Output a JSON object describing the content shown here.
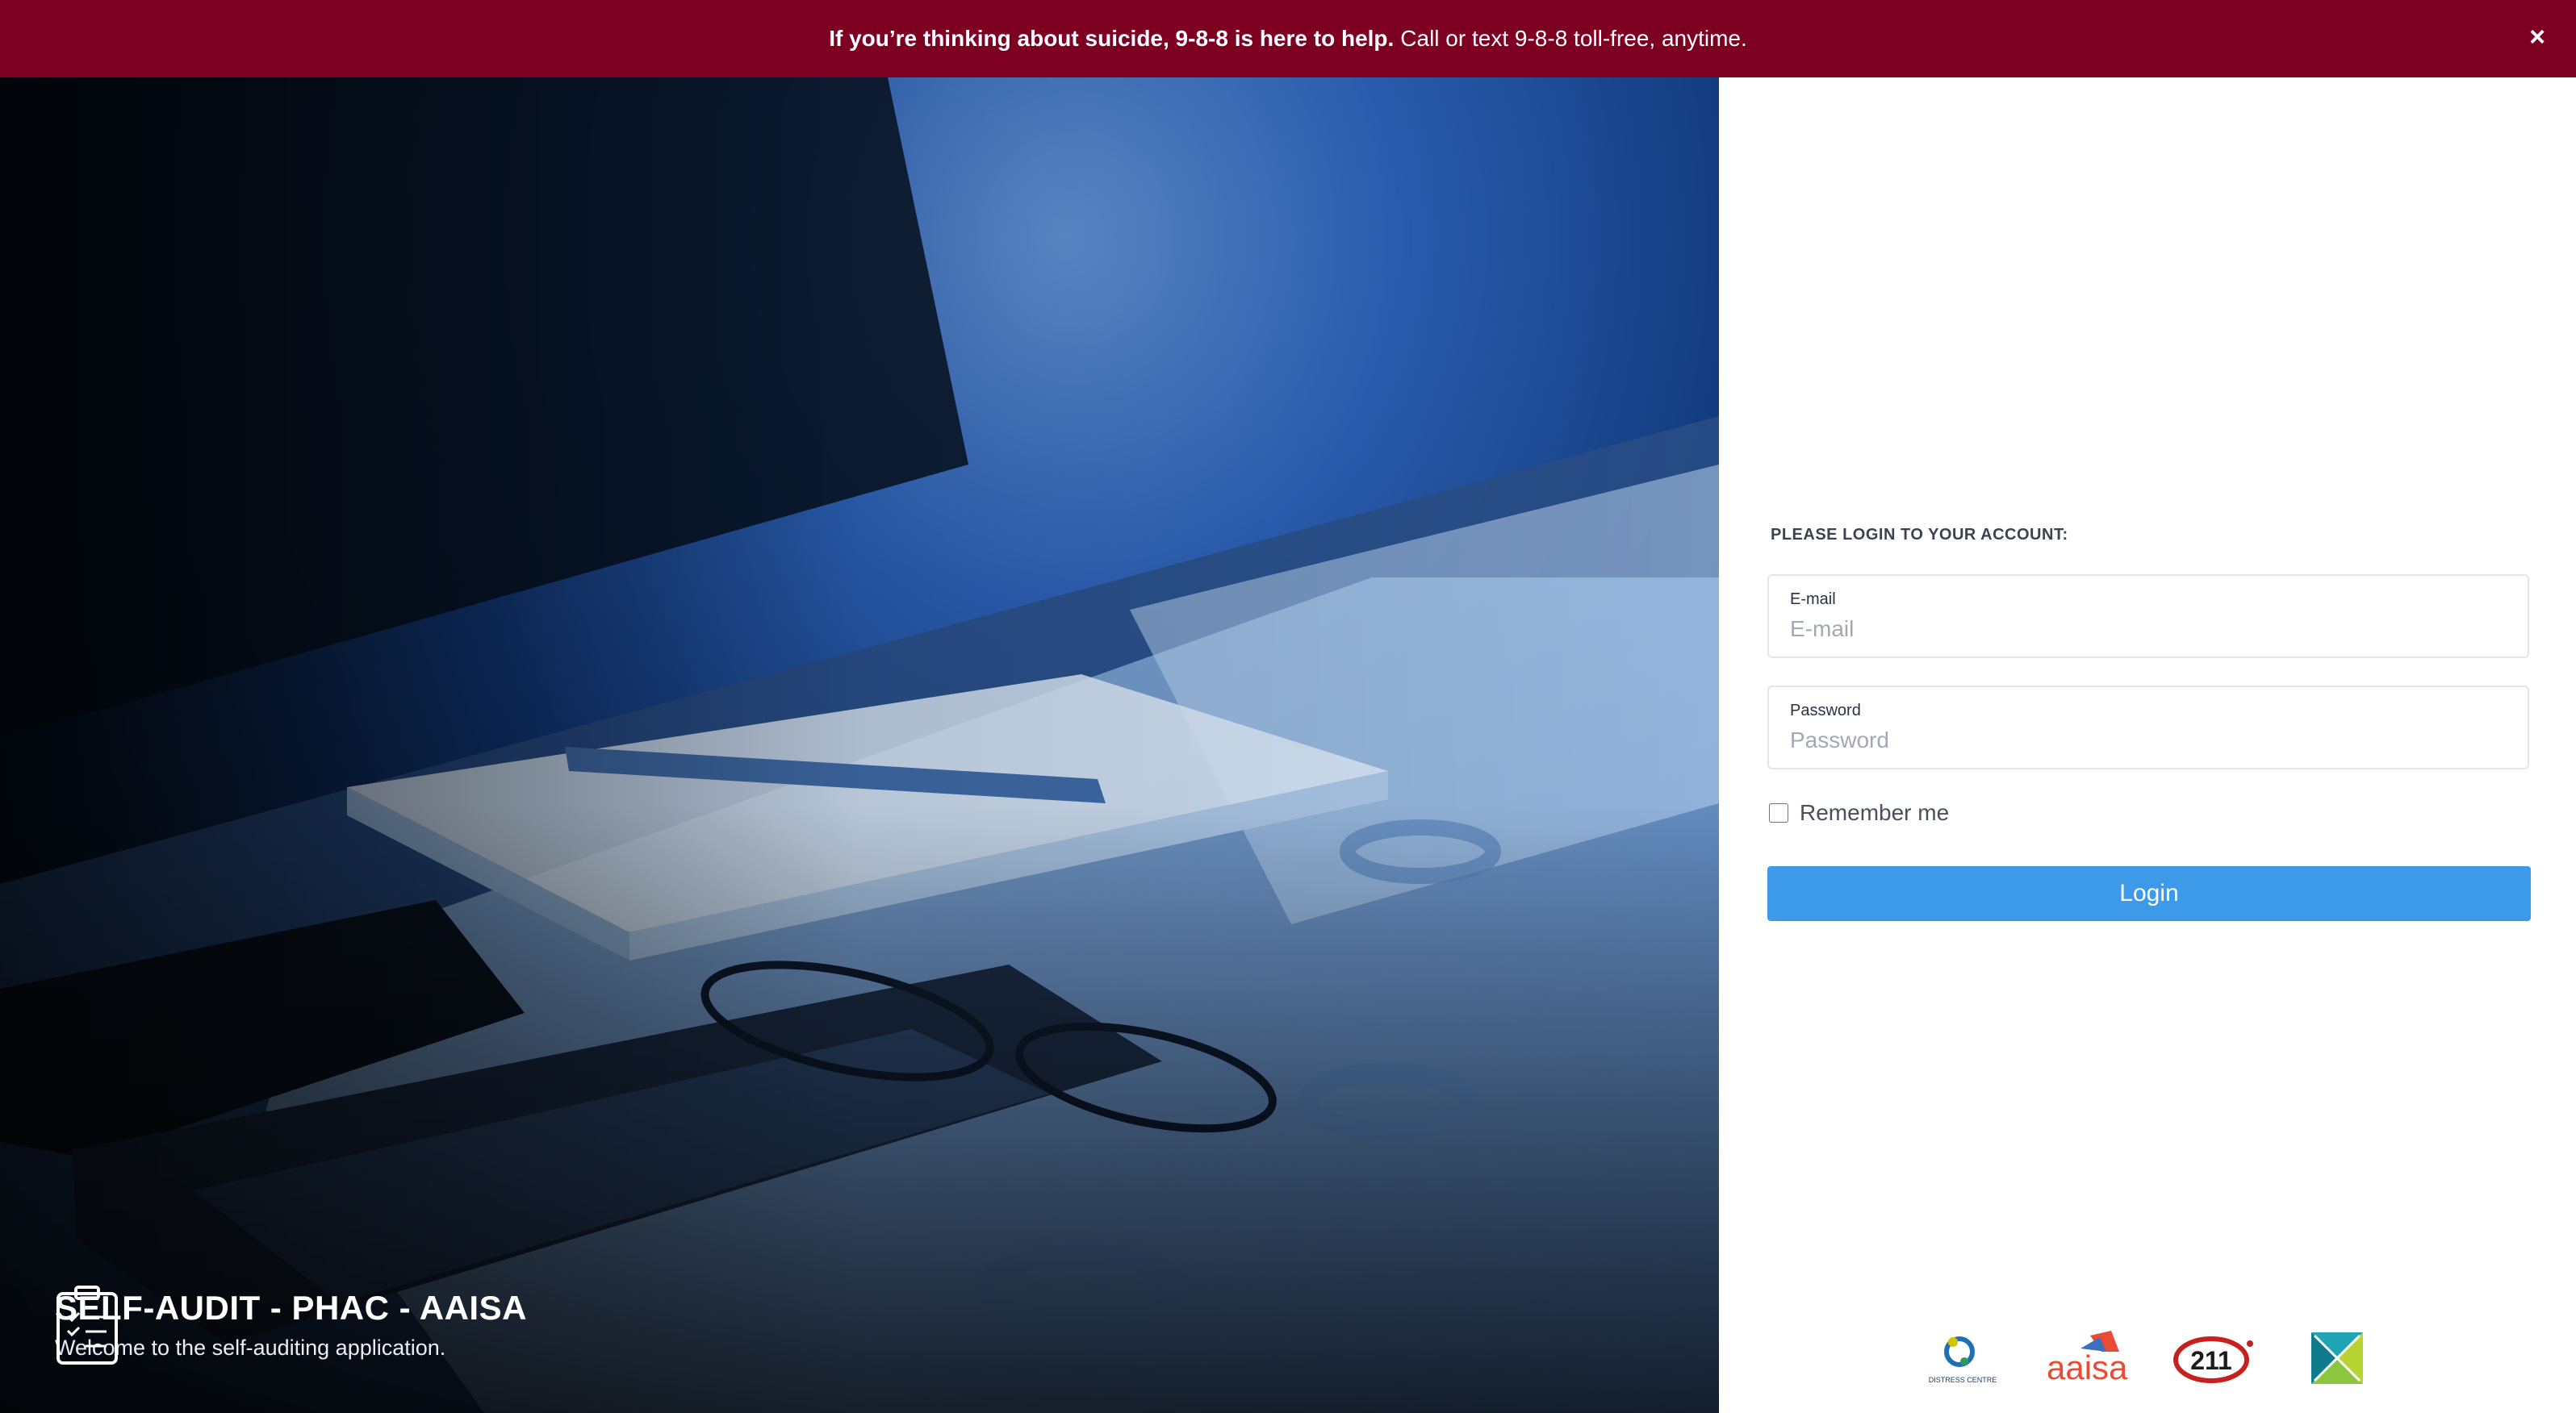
{
  "banner": {
    "bold_text": "If you’re thinking about suicide, 9-8-8 is here to help.",
    "text": "Call or text 9-8-8 toll-free, anytime.",
    "close": "×",
    "color": "#7d0022"
  },
  "hero": {
    "title": "SELF-AUDIT - PHAC - AAISA",
    "subtitle": "Welcome to the self-auditing application.",
    "icon": "clipboard-checklist-icon"
  },
  "login": {
    "heading": "PLEASE LOGIN TO YOUR ACCOUNT:",
    "email_label": "E-mail",
    "email_placeholder": "E-mail",
    "email_value": "",
    "password_label": "Password",
    "password_placeholder": "Password",
    "password_value": "",
    "remember_label": "Remember me",
    "remember_checked": false,
    "button_label": "Login",
    "button_color": "#3d9ae8"
  },
  "logos": {
    "distress_centre_text": "DISTRESS CENTRE",
    "aaisa_text": "aaisa",
    "two11_text": "211"
  }
}
